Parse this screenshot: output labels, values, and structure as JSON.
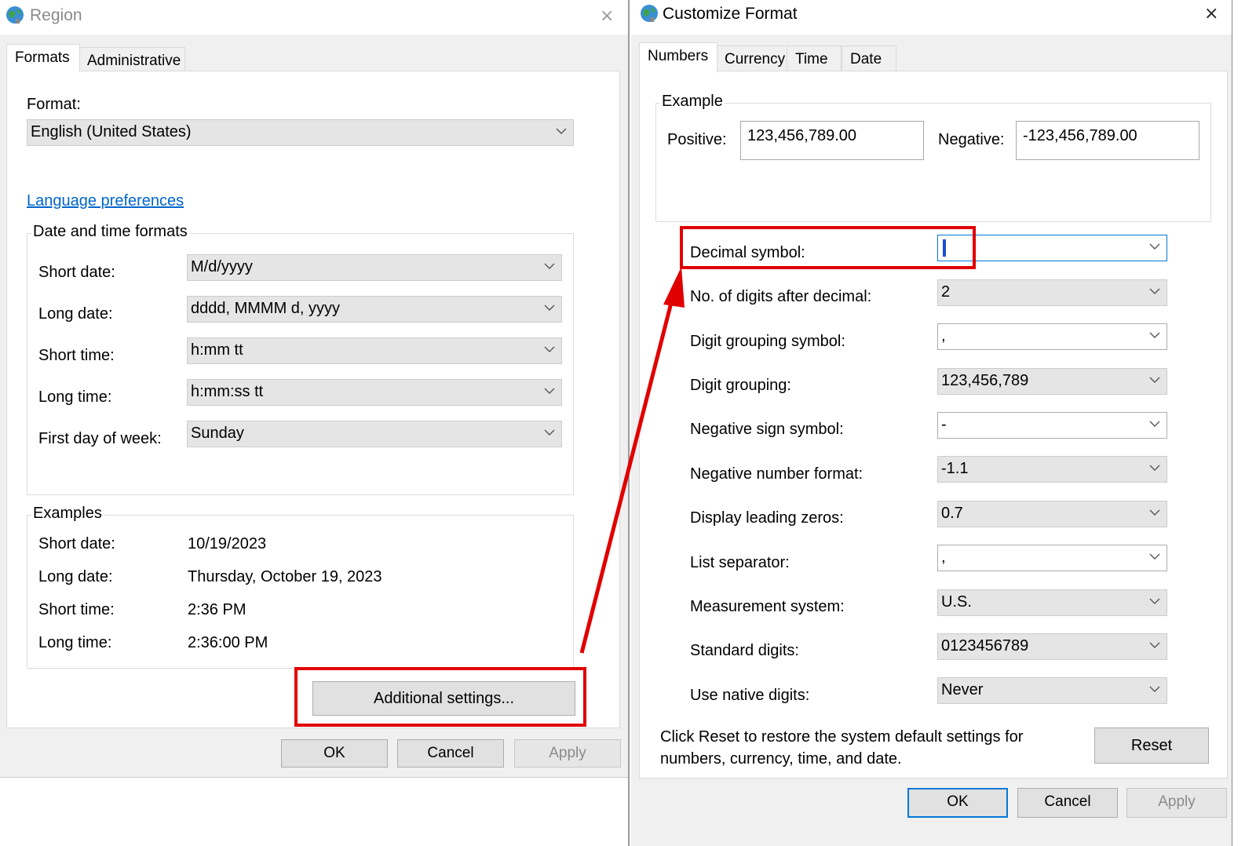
{
  "region": {
    "title": "Region",
    "close": "×",
    "tabs": [
      "Formats",
      "Administrative"
    ],
    "format_label": "Format:",
    "format_value": "English (United States)",
    "language_link": "Language preferences",
    "date_time_group": "Date and time formats",
    "fields": [
      {
        "label": "Short date:",
        "value": "M/d/yyyy"
      },
      {
        "label": "Long date:",
        "value": "dddd, MMMM d, yyyy"
      },
      {
        "label": "Short time:",
        "value": "h:mm tt"
      },
      {
        "label": "Long time:",
        "value": "h:mm:ss tt"
      },
      {
        "label": "First day of week:",
        "value": "Sunday"
      }
    ],
    "examples_group": "Examples",
    "examples": [
      {
        "label": "Short date:",
        "value": "10/19/2023"
      },
      {
        "label": "Long date:",
        "value": "Thursday, October 19, 2023"
      },
      {
        "label": "Short time:",
        "value": "2:36 PM"
      },
      {
        "label": "Long time:",
        "value": "2:36:00 PM"
      }
    ],
    "additional_settings": "Additional settings...",
    "ok": "OK",
    "cancel": "Cancel",
    "apply": "Apply"
  },
  "customize": {
    "title": "Customize Format",
    "close": "×",
    "tabs": [
      "Numbers",
      "Currency",
      "Time",
      "Date"
    ],
    "example_group": "Example",
    "positive_label": "Positive:",
    "positive_value": "123,456,789.00",
    "negative_label": "Negative:",
    "negative_value": "-123,456,789.00",
    "settings": [
      {
        "label": "Decimal symbol:",
        "value": ""
      },
      {
        "label": "No. of digits after decimal:",
        "value": "2"
      },
      {
        "label": "Digit grouping symbol:",
        "value": ","
      },
      {
        "label": "Digit grouping:",
        "value": "123,456,789"
      },
      {
        "label": "Negative sign symbol:",
        "value": "-"
      },
      {
        "label": "Negative number format:",
        "value": "-1.1"
      },
      {
        "label": "Display leading zeros:",
        "value": "0.7"
      },
      {
        "label": "List separator:",
        "value": ","
      },
      {
        "label": "Measurement system:",
        "value": "U.S."
      },
      {
        "label": "Standard digits:",
        "value": "0123456789"
      },
      {
        "label": "Use native digits:",
        "value": "Never"
      }
    ],
    "reset_note_line1": "Click Reset to restore the system default settings for",
    "reset_note_line2": "numbers, currency, time, and date.",
    "reset": "Reset",
    "ok": "OK",
    "cancel": "Cancel",
    "apply": "Apply"
  },
  "colors": {
    "highlight": "#e10000",
    "focus": "#0078d7",
    "link": "#0066cc"
  }
}
